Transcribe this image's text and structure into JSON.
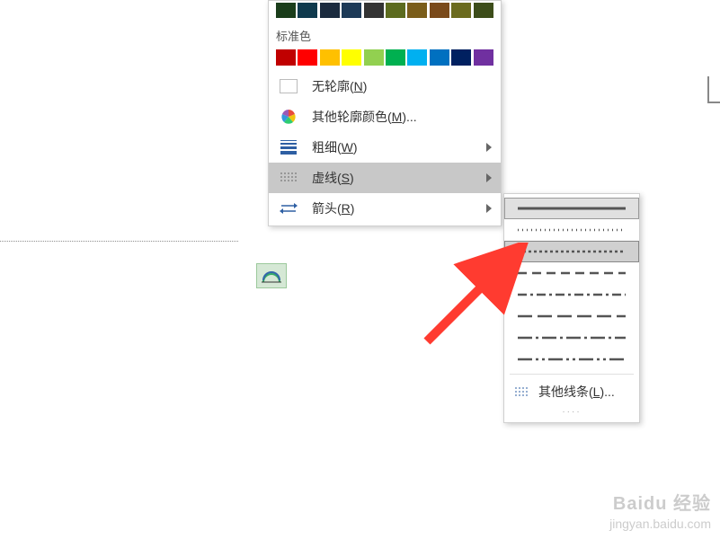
{
  "theme_colors_row": [
    "#1a3d1a",
    "#0f3a4d",
    "#1b2b3f",
    "#1d3a57",
    "#333333",
    "#5c6b1e",
    "#7a5d1a",
    "#7a4a1a",
    "#6b6b1e",
    "#3d4d1a"
  ],
  "section_labels": {
    "standard": "标准色"
  },
  "standard_colors": [
    "#c00000",
    "#ff0000",
    "#ffc000",
    "#ffff00",
    "#92d050",
    "#00b050",
    "#00b0f0",
    "#0070c0",
    "#002060",
    "#7030a0"
  ],
  "menu": {
    "no_outline": {
      "prefix": "无轮廓(",
      "key": "N",
      "suffix": ")"
    },
    "more_colors": {
      "prefix": "其他轮廓颜色(",
      "key": "M",
      "suffix": ")..."
    },
    "weight": {
      "prefix": "粗细(",
      "key": "W",
      "suffix": ")"
    },
    "dash": {
      "prefix": "虚线(",
      "key": "S",
      "suffix": ")"
    },
    "arrow": {
      "prefix": "箭头(",
      "key": "R",
      "suffix": ")"
    }
  },
  "submenu": {
    "more_lines": {
      "prefix": "其他线条(",
      "key": "L",
      "suffix": ")..."
    }
  },
  "dash_styles": [
    {
      "name": "solid",
      "dasharray": ""
    },
    {
      "name": "round-dot",
      "dasharray": "1 4"
    },
    {
      "name": "square-dot",
      "dasharray": "3 3"
    },
    {
      "name": "dash",
      "dasharray": "10 6"
    },
    {
      "name": "dash-dot",
      "dasharray": "10 4 3 4"
    },
    {
      "name": "long-dash",
      "dasharray": "16 6"
    },
    {
      "name": "long-dash-dot",
      "dasharray": "16 4 3 4"
    },
    {
      "name": "long-dash-dot-dot",
      "dasharray": "16 4 3 4 3 4"
    }
  ],
  "watermark": {
    "brand": "Baidu 经验",
    "url": "jingyan.baidu.com"
  }
}
